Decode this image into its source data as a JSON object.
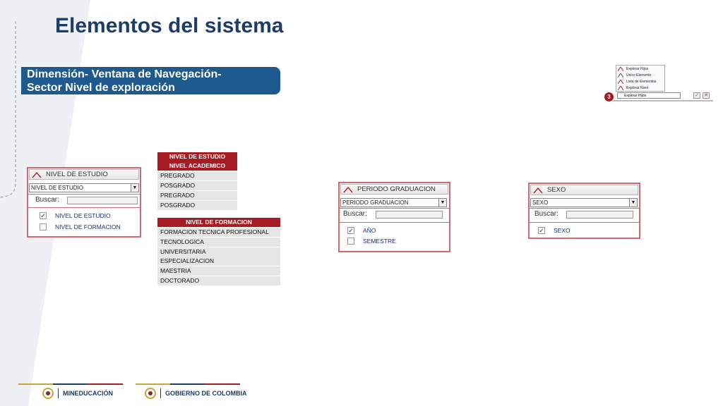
{
  "slide": {
    "title": "Elementos del sistema",
    "subtitle_line1": "Dimensión- Ventana de Navegación-",
    "subtitle_line2": "Sector Nivel de exploración"
  },
  "mini_screenshot": {
    "badge": "3",
    "menu_items": [
      "Explorar Hijos",
      "Único Elemento",
      "Lista de Elementos",
      "Explorar Nivel"
    ],
    "selected": "Explorar Hijos",
    "ok_glyph": "✓",
    "cancel_glyph": "✕"
  },
  "widgets": {
    "nivel_estudio": {
      "header": "NIVEL DE ESTUDIO",
      "select_value": "NIVEL DE ESTUDIO",
      "search_label": "Buscar:",
      "options": [
        {
          "label": "NIVEL DE ESTUDIO",
          "checked": true
        },
        {
          "label": "NIVEL DE FORMACION",
          "checked": false
        }
      ]
    },
    "periodo_graduacion": {
      "header": "PERIODO GRADUACION",
      "select_value": "PERIODO GRADUACION",
      "search_label": "Buscar:",
      "options": [
        {
          "label": "AÑO",
          "checked": true
        },
        {
          "label": "SEMESTRE",
          "checked": false
        }
      ]
    },
    "sexo": {
      "header": "SEXO",
      "select_value": "SEXO",
      "search_label": "Buscar:",
      "options": [
        {
          "label": "SEXO",
          "checked": true
        }
      ]
    }
  },
  "tables": {
    "nivel_estudio": {
      "header1": "NIVEL DE ESTUDIO",
      "header2": "NIVEL ACADEMICO",
      "rows": [
        "PREGRADO",
        "POSGRADO",
        "PREGRADO",
        "POSGRADO"
      ]
    },
    "nivel_formacion": {
      "header": "NIVEL DE FORMACION",
      "rows": [
        "FORMACION TECNICA PROFESIONAL",
        "TECNOLOGICA",
        "UNIVERSITARIA",
        "ESPECIALIZACION",
        "MAESTRIA",
        "DOCTORADO"
      ]
    }
  },
  "footer": {
    "logo1": "MINEDUCACIÓN",
    "logo2": "GOBIERNO DE COLOMBIA"
  },
  "colors": {
    "title": "#1c3d66",
    "subtitle_bg": "#1f5a8e",
    "table_header": "#a61c22",
    "widget_border": "#d06a6e",
    "accent_red": "#a11d24"
  }
}
